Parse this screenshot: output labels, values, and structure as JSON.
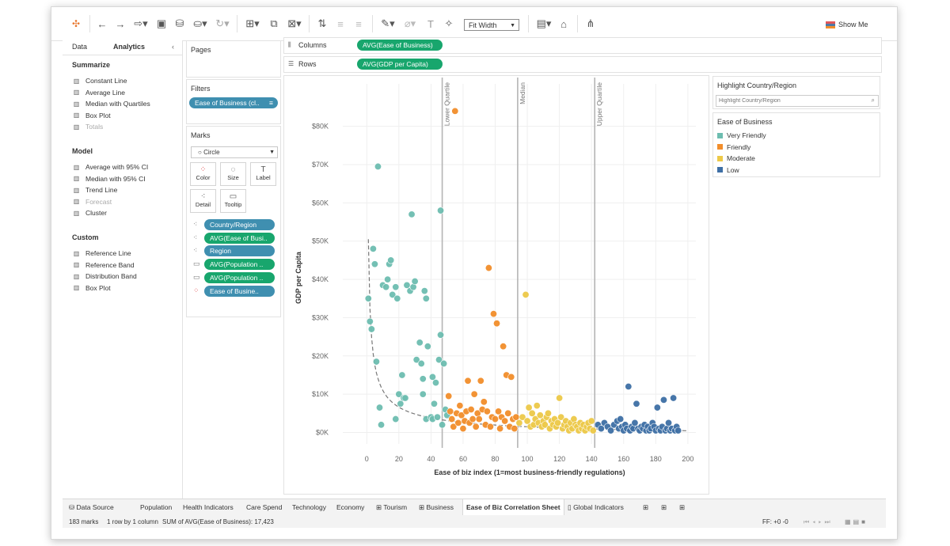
{
  "toolbar": {
    "fit_label": "Fit Width",
    "show_me_label": "Show Me",
    "icons": [
      "tableau-logo-icon",
      "undo-icon",
      "redo-icon",
      "replay-icon",
      "save-icon",
      "new-datasource-icon",
      "pause-icon",
      "refresh-icon",
      "new-sheet-icon",
      "duplicate-sheet-icon",
      "clear-sheet-icon",
      "swap-icon",
      "sort-ascending-icon",
      "sort-descending-icon",
      "highlight-icon",
      "group-icon",
      "label-icon",
      "pin-icon",
      "show-cards-icon",
      "presentation-icon",
      "share-icon"
    ]
  },
  "left_pane": {
    "tabs": {
      "data": "Data",
      "analytics": "Analytics"
    },
    "summarize": {
      "title": "Summarize",
      "items": [
        {
          "label": "Constant Line",
          "icon": "constant-line-icon",
          "enabled": true
        },
        {
          "label": "Average Line",
          "icon": "average-line-icon",
          "enabled": true
        },
        {
          "label": "Median with Quartiles",
          "icon": "median-quartiles-icon",
          "enabled": true
        },
        {
          "label": "Box Plot",
          "icon": "box-plot-icon",
          "enabled": true
        },
        {
          "label": "Totals",
          "icon": "totals-icon",
          "enabled": false
        }
      ]
    },
    "model": {
      "title": "Model",
      "items": [
        {
          "label": "Average with 95% CI",
          "icon": "average-ci-icon",
          "enabled": true
        },
        {
          "label": "Median with 95% CI",
          "icon": "median-ci-icon",
          "enabled": true
        },
        {
          "label": "Trend Line",
          "icon": "trend-line-icon",
          "enabled": true
        },
        {
          "label": "Forecast",
          "icon": "forecast-icon",
          "enabled": false
        },
        {
          "label": "Cluster",
          "icon": "cluster-icon",
          "enabled": true
        }
      ]
    },
    "custom": {
      "title": "Custom",
      "items": [
        {
          "label": "Reference Line",
          "icon": "reference-line-icon",
          "enabled": true
        },
        {
          "label": "Reference Band",
          "icon": "reference-band-icon",
          "enabled": true
        },
        {
          "label": "Distribution Band",
          "icon": "distribution-band-icon",
          "enabled": true
        },
        {
          "label": "Box Plot",
          "icon": "box-plot-icon",
          "enabled": true
        }
      ]
    }
  },
  "pages": {
    "title": "Pages"
  },
  "filters": {
    "title": "Filters",
    "pill": "Ease of Business (cl.."
  },
  "marks": {
    "title": "Marks",
    "mark_type": "Circle",
    "buttons": [
      "Color",
      "Size",
      "Label",
      "Detail",
      "Tooltip"
    ],
    "fields": [
      {
        "label": "Country/Region",
        "color": "blue",
        "icon": "detail-icon"
      },
      {
        "label": "AVG(Ease of Busi..",
        "color": "green",
        "icon": "detail-icon"
      },
      {
        "label": "Region",
        "color": "blue",
        "icon": "detail-icon"
      },
      {
        "label": "AVG(Population ..",
        "color": "green",
        "icon": "tooltip-icon"
      },
      {
        "label": "AVG(Population ..",
        "color": "green",
        "icon": "tooltip-icon"
      },
      {
        "label": "Ease of Busine..",
        "color": "blue",
        "icon": "color-icon"
      }
    ]
  },
  "shelves": {
    "columns_label": "Columns",
    "columns_pill": "AVG(Ease of Business)",
    "rows_label": "Rows",
    "rows_pill": "AVG(GDP per Capita)"
  },
  "highlight": {
    "title": "Highlight Country/Region",
    "placeholder": "Highlight Country/Region"
  },
  "legend": {
    "title": "Ease of Business",
    "items": [
      {
        "label": "Very Friendly",
        "color": "#6dbdb0"
      },
      {
        "label": "Friendly",
        "color": "#f28e2b"
      },
      {
        "label": "Moderate",
        "color": "#edc948"
      },
      {
        "label": "Low",
        "color": "#3e6fa5"
      }
    ]
  },
  "sheet_tabs": [
    {
      "label": "Data Source",
      "icon": "datasource-icon",
      "active": false
    },
    {
      "label": "Population",
      "icon": "",
      "active": false
    },
    {
      "label": "Health Indicators",
      "icon": "",
      "active": false
    },
    {
      "label": "Care Spend",
      "icon": "",
      "active": false
    },
    {
      "label": "Technology",
      "icon": "",
      "active": false
    },
    {
      "label": "Economy",
      "icon": "",
      "active": false
    },
    {
      "label": "Tourism",
      "icon": "dashboard-icon",
      "active": false
    },
    {
      "label": "Business",
      "icon": "dashboard-icon",
      "active": false
    },
    {
      "label": "Ease of Biz Correlation Sheet",
      "icon": "",
      "active": true
    },
    {
      "label": "Global Indicators",
      "icon": "story-icon",
      "active": false
    }
  ],
  "status": {
    "marks": "183 marks",
    "rows_cols": "1 row by 1 column",
    "sum": "SUM of AVG(Ease of Business): 17,423",
    "ff": "FF: +0 -0"
  },
  "chart_data": {
    "type": "scatter",
    "title": "",
    "xlabel": "Ease of biz index (1=most business-friendly regulations)",
    "ylabel": "GDP per Capita",
    "xlim": [
      -10,
      205
    ],
    "ylim": [
      -3000,
      88000
    ],
    "x_ticks": [
      0,
      20,
      40,
      60,
      80,
      100,
      120,
      140,
      160,
      180,
      200
    ],
    "y_ticks": [
      0,
      10000,
      20000,
      30000,
      40000,
      50000,
      60000,
      70000,
      80000
    ],
    "y_tick_labels": [
      "$0K",
      "$10K",
      "$20K",
      "$30K",
      "$40K",
      "$50K",
      "$60K",
      "$70K",
      "$80K"
    ],
    "reference_lines": [
      {
        "label": "Lower Quartile",
        "x": 47
      },
      {
        "label": "Median",
        "x": 94
      },
      {
        "label": "Upper Quartile",
        "x": 142
      }
    ],
    "trend_line": "power",
    "series": [
      {
        "name": "Very Friendly",
        "color": "#6dbdb0",
        "points": [
          [
            1,
            35000
          ],
          [
            2,
            29000
          ],
          [
            3,
            27000
          ],
          [
            4,
            48000
          ],
          [
            5,
            44000
          ],
          [
            6,
            18500
          ],
          [
            7,
            69500
          ],
          [
            8,
            6500
          ],
          [
            9,
            2000
          ],
          [
            10,
            38500
          ],
          [
            12,
            38000
          ],
          [
            13,
            40000
          ],
          [
            14,
            44000
          ],
          [
            15,
            45000
          ],
          [
            16,
            36000
          ],
          [
            18,
            38000
          ],
          [
            18,
            3500
          ],
          [
            19,
            35000
          ],
          [
            20,
            10000
          ],
          [
            21,
            7500
          ],
          [
            22,
            15000
          ],
          [
            23,
            9000
          ],
          [
            24,
            9000
          ],
          [
            25,
            38500
          ],
          [
            27,
            37000
          ],
          [
            28,
            57000
          ],
          [
            29,
            38000
          ],
          [
            30,
            39500
          ],
          [
            31,
            19000
          ],
          [
            33,
            23500
          ],
          [
            34,
            18000
          ],
          [
            35,
            14000
          ],
          [
            35,
            10000
          ],
          [
            36,
            37000
          ],
          [
            37,
            35000
          ],
          [
            37,
            3500
          ],
          [
            38,
            22500
          ],
          [
            40,
            4000
          ],
          [
            41,
            14500
          ],
          [
            41,
            3500
          ],
          [
            42,
            7500
          ],
          [
            43,
            13000
          ],
          [
            44,
            4000
          ],
          [
            45,
            19000
          ],
          [
            46,
            58000
          ],
          [
            46,
            25500
          ],
          [
            47,
            2000
          ],
          [
            48,
            18000
          ],
          [
            49,
            6000
          ],
          [
            50,
            4500
          ]
        ]
      },
      {
        "name": "Friendly",
        "color": "#f28e2b",
        "points": [
          [
            51,
            9500
          ],
          [
            52,
            5500
          ],
          [
            53,
            3500
          ],
          [
            54,
            1500
          ],
          [
            55,
            84000
          ],
          [
            56,
            5000
          ],
          [
            57,
            2500
          ],
          [
            58,
            7000
          ],
          [
            59,
            4500
          ],
          [
            60,
            1000
          ],
          [
            61,
            3000
          ],
          [
            62,
            5500
          ],
          [
            63,
            13500
          ],
          [
            64,
            2500
          ],
          [
            65,
            6000
          ],
          [
            66,
            3500
          ],
          [
            67,
            10000
          ],
          [
            68,
            1500
          ],
          [
            69,
            5000
          ],
          [
            70,
            3500
          ],
          [
            71,
            13500
          ],
          [
            72,
            6000
          ],
          [
            73,
            8000
          ],
          [
            74,
            2000
          ],
          [
            75,
            5500
          ],
          [
            76,
            43000
          ],
          [
            77,
            1500
          ],
          [
            78,
            4000
          ],
          [
            79,
            31000
          ],
          [
            80,
            3500
          ],
          [
            81,
            28500
          ],
          [
            82,
            5500
          ],
          [
            83,
            1000
          ],
          [
            84,
            4000
          ],
          [
            85,
            22500
          ],
          [
            86,
            3000
          ],
          [
            87,
            15000
          ],
          [
            88,
            5000
          ],
          [
            89,
            1500
          ],
          [
            90,
            14500
          ],
          [
            91,
            3500
          ],
          [
            92,
            1000
          ],
          [
            93,
            4000
          ]
        ]
      },
      {
        "name": "Moderate",
        "color": "#edc948",
        "points": [
          [
            95,
            2500
          ],
          [
            97,
            4000
          ],
          [
            99,
            36000
          ],
          [
            100,
            3000
          ],
          [
            101,
            6500
          ],
          [
            102,
            1500
          ],
          [
            103,
            5000
          ],
          [
            104,
            2000
          ],
          [
            105,
            3500
          ],
          [
            106,
            7000
          ],
          [
            107,
            2500
          ],
          [
            108,
            4500
          ],
          [
            109,
            1500
          ],
          [
            110,
            3000
          ],
          [
            111,
            2000
          ],
          [
            112,
            4000
          ],
          [
            113,
            5000
          ],
          [
            114,
            1000
          ],
          [
            115,
            3000
          ],
          [
            116,
            2000
          ],
          [
            117,
            3500
          ],
          [
            118,
            1500
          ],
          [
            119,
            2500
          ],
          [
            120,
            9000
          ],
          [
            121,
            4000
          ],
          [
            122,
            1000
          ],
          [
            123,
            2000
          ],
          [
            124,
            3000
          ],
          [
            125,
            1500
          ],
          [
            126,
            500
          ],
          [
            127,
            2500
          ],
          [
            128,
            1000
          ],
          [
            129,
            3500
          ],
          [
            130,
            2000
          ],
          [
            131,
            1500
          ],
          [
            132,
            500
          ],
          [
            133,
            2500
          ],
          [
            134,
            1000
          ],
          [
            135,
            2000
          ],
          [
            136,
            500
          ],
          [
            137,
            1500
          ],
          [
            138,
            2500
          ],
          [
            139,
            1000
          ],
          [
            140,
            3000
          ],
          [
            141,
            500
          ]
        ]
      },
      {
        "name": "Low",
        "color": "#3e6fa5",
        "points": [
          [
            144,
            2000
          ],
          [
            146,
            1000
          ],
          [
            148,
            2500
          ],
          [
            150,
            1500
          ],
          [
            152,
            500
          ],
          [
            154,
            2000
          ],
          [
            156,
            3000
          ],
          [
            157,
            1000
          ],
          [
            158,
            3500
          ],
          [
            159,
            1500
          ],
          [
            160,
            500
          ],
          [
            161,
            2000
          ],
          [
            162,
            1000
          ],
          [
            163,
            12000
          ],
          [
            164,
            500
          ],
          [
            165,
            1500
          ],
          [
            166,
            1000
          ],
          [
            167,
            2500
          ],
          [
            168,
            7500
          ],
          [
            169,
            1000
          ],
          [
            170,
            500
          ],
          [
            171,
            1500
          ],
          [
            172,
            1000
          ],
          [
            173,
            2000
          ],
          [
            174,
            500
          ],
          [
            175,
            1500
          ],
          [
            176,
            500
          ],
          [
            177,
            1000
          ],
          [
            178,
            2500
          ],
          [
            179,
            1500
          ],
          [
            180,
            500
          ],
          [
            181,
            6500
          ],
          [
            182,
            1000
          ],
          [
            183,
            500
          ],
          [
            184,
            1500
          ],
          [
            185,
            8500
          ],
          [
            186,
            500
          ],
          [
            187,
            1000
          ],
          [
            188,
            2500
          ],
          [
            189,
            500
          ],
          [
            190,
            1000
          ],
          [
            191,
            9000
          ],
          [
            192,
            500
          ],
          [
            193,
            1500
          ],
          [
            194,
            500
          ]
        ]
      }
    ]
  }
}
